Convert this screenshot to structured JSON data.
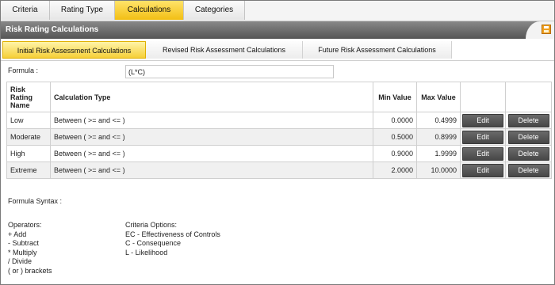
{
  "top_tabs": [
    "Criteria",
    "Rating Type",
    "Calculations",
    "Categories"
  ],
  "title": "Risk Rating Calculations",
  "sub_tabs": [
    "Initial Risk Assessment Calculations",
    "Revised Risk Assessment Calculations",
    "Future Risk Assessment Calculations"
  ],
  "formula": {
    "label": "Formula :",
    "value": "(L*C)"
  },
  "table": {
    "headers": {
      "name": "Risk Rating Name",
      "type": "Calculation Type",
      "min": "Min Value",
      "max": "Max Value"
    },
    "rows": [
      {
        "name": "Low",
        "type": "Between ( >= and <= )",
        "min": "0.0000",
        "max": "0.4999",
        "edit": "Edit",
        "delete": "Delete"
      },
      {
        "name": "Moderate",
        "type": "Between ( >= and <= )",
        "min": "0.5000",
        "max": "0.8999",
        "edit": "Edit",
        "delete": "Delete"
      },
      {
        "name": "High",
        "type": "Between ( >= and <= )",
        "min": "0.9000",
        "max": "1.9999",
        "edit": "Edit",
        "delete": "Delete"
      },
      {
        "name": "Extreme",
        "type": "Between ( >= and <= )",
        "min": "2.0000",
        "max": "10.0000",
        "edit": "Edit",
        "delete": "Delete"
      }
    ]
  },
  "syntax": {
    "title": "Formula Syntax :",
    "operators_title": "Operators:",
    "operators": [
      "+ Add",
      "- Subtract",
      "* Multiply",
      "/ Divide",
      "( or ) brackets"
    ],
    "criteria_title": "Criteria Options:",
    "criteria": [
      "EC - Effectiveness of Controls",
      "C - Consequence",
      "L - Likelihood"
    ]
  },
  "icons": {
    "save": "save-icon"
  },
  "colors": {
    "active_tab": "#f6cf38",
    "title_bar": "#666666",
    "button": "#555555"
  }
}
